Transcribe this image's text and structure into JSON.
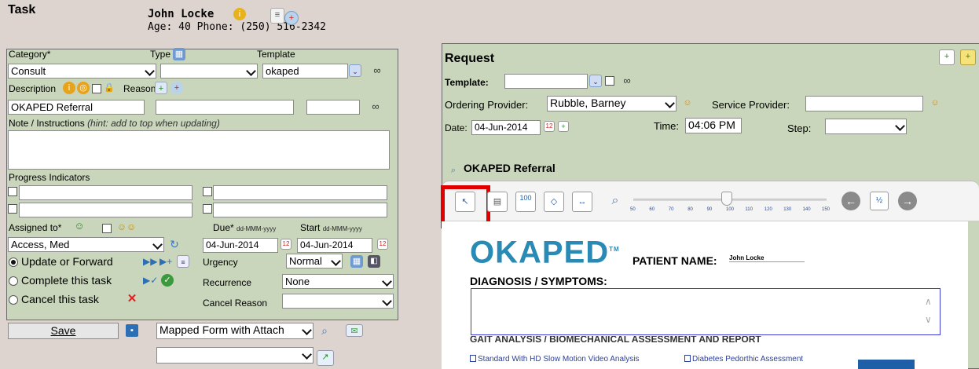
{
  "header": {
    "title": "Task",
    "patient_name": "John Locke",
    "patient_info": "Age: 40 Phone: (250) 516-2342"
  },
  "task": {
    "category_label": "Category*",
    "type_label": "Type",
    "template_label": "Template",
    "category_value": "Consult",
    "type_value": "",
    "template_value": "okaped",
    "description_label": "Description",
    "reason_label": "Reason",
    "description_value": "OKAPED Referral",
    "reason_value": "",
    "note_label": "Note / Instructions",
    "note_hint": "(hint: add to top when updating)",
    "note_value": "",
    "progress_label": "Progress Indicators",
    "assigned_label": "Assigned to*",
    "due_label": "Due*",
    "date_format": "dd-MMM-yyyy",
    "start_label": "Start",
    "assigned_value": "Access, Med",
    "due_value": "04-Jun-2014",
    "start_value": "04-Jun-2014",
    "opt_update": "Update or Forward",
    "opt_complete": "Complete this task",
    "opt_cancel": "Cancel this task",
    "urgency_label": "Urgency",
    "urgency_value": "Normal",
    "recurrence_label": "Recurrence",
    "recurrence_value": "None",
    "cancel_reason_label": "Cancel Reason",
    "cancel_reason_value": "",
    "save_label": "Save",
    "form_select_value": "Mapped Form with Attach",
    "form_select2_value": ""
  },
  "request": {
    "title": "Request",
    "template_label": "Template:",
    "template_value": "",
    "ordering_label": "Ordering Provider:",
    "ordering_value": "Rubble, Barney",
    "service_label": "Service Provider:",
    "service_value": "",
    "date_label": "Date:",
    "date_value": "04-Jun-2014",
    "time_label": "Time:",
    "time_value": "04:06 PM",
    "step_label": "Step:",
    "step_value": "",
    "section_title": "OKAPED Referral"
  },
  "viewer": {
    "zoom_ticks": [
      "50",
      "60",
      "70",
      "80",
      "90",
      "100",
      "110",
      "120",
      "130",
      "140",
      "150"
    ],
    "zoom_value": 100,
    "page_button_label": "100"
  },
  "document": {
    "logo": "OKAPED",
    "tm": "TM",
    "patient_name_label": "PATIENT NAME:",
    "patient_name_value": "John Locke",
    "diagnosis_label": "DIAGNOSIS / SYMPTOMS:",
    "section_heading": "GAIT ANALYSIS / BIOMECHANICAL ASSESSMENT AND REPORT",
    "option1": "Standard With HD Slow Motion Video Analysis",
    "option2": "Diabetes Pedorthic Assessment"
  },
  "colors": {
    "panel_bg": "#c9d6bb",
    "page_bg": "#ddd3cf",
    "highlight": "#e00000",
    "logo": "#2a8ab6"
  }
}
